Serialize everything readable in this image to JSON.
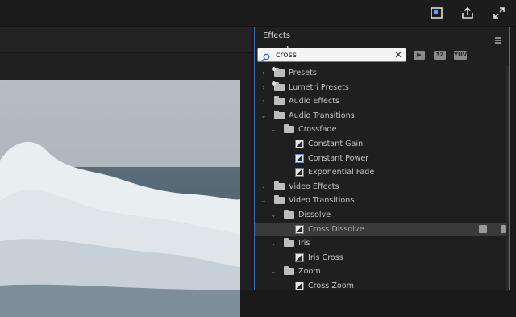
{
  "effects_panel": {
    "title": "Effects",
    "search": {
      "value": "cross",
      "placeholder": ""
    },
    "toolbar": {
      "badge_32": "32",
      "badge_yuv": "YUV"
    },
    "tree": [
      {
        "label": "Presets",
        "expanded": false,
        "type": "folder",
        "star": true
      },
      {
        "label": "Lumetri Presets",
        "expanded": false,
        "type": "folder",
        "star": true
      },
      {
        "label": "Audio Effects",
        "expanded": false,
        "type": "folder"
      },
      {
        "label": "Audio Transitions",
        "expanded": true,
        "type": "folder"
      },
      {
        "label": "Crossfade",
        "expanded": true,
        "type": "folder"
      },
      {
        "label": "Constant Gain",
        "type": "effect"
      },
      {
        "label": "Constant Power",
        "type": "effect",
        "selected_icon": true
      },
      {
        "label": "Exponential Fade",
        "type": "effect"
      },
      {
        "label": "Video Effects",
        "expanded": false,
        "type": "folder"
      },
      {
        "label": "Video Transitions",
        "expanded": true,
        "type": "folder"
      },
      {
        "label": "Dissolve",
        "expanded": true,
        "type": "folder"
      },
      {
        "label": "Cross Dissolve",
        "type": "effect",
        "selected": true
      },
      {
        "label": "Iris",
        "expanded": true,
        "type": "folder"
      },
      {
        "label": "Iris Cross",
        "type": "effect"
      },
      {
        "label": "Zoom",
        "expanded": true,
        "type": "folder"
      },
      {
        "label": "Cross Zoom",
        "type": "effect"
      }
    ]
  },
  "topbar": {
    "icons": [
      "quick-export-icon",
      "share-icon",
      "fullscreen-icon"
    ]
  },
  "colors": {
    "accent": "#3d6fb8",
    "panel_bg": "#1f1f1f",
    "selection": "#3a3a3a"
  }
}
